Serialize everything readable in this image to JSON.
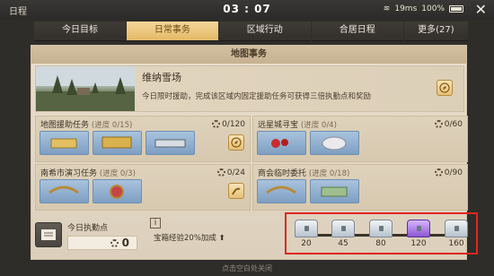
{
  "statusbar": {
    "title": "日程",
    "clock": "03 : 07",
    "speed": "19ms",
    "battery": "100%",
    "close": "✕"
  },
  "tabs": [
    "今日目标",
    "日常事务",
    "区域行动",
    "合居日程",
    "更多(27)"
  ],
  "panel": {
    "header": "地图事务",
    "feature": {
      "name": "维纳雪场",
      "desc": "今日限时援助，完成该区域内固定援助任务可获得三倍执勤点和奖励"
    },
    "cards": [
      {
        "title": "地图援助任务",
        "progress": "(进度 0/15)",
        "count": "0/120"
      },
      {
        "title": "远星城寻宝",
        "progress": "(进度 0/4)",
        "count": "0/60"
      },
      {
        "title": "南希市演习任务",
        "progress": "(进度 0/3)",
        "count": "0/24"
      },
      {
        "title": "商会临时委托",
        "progress": "(进度 0/18)",
        "count": "0/90"
      }
    ],
    "points": {
      "label": "今日执勤点",
      "value": "0",
      "info": "i"
    },
    "bonus": "宝箱经验20%加成 ⬆",
    "chests": [
      "20",
      "45",
      "80",
      "120",
      "160"
    ]
  },
  "footer": "点击空白处关闭"
}
